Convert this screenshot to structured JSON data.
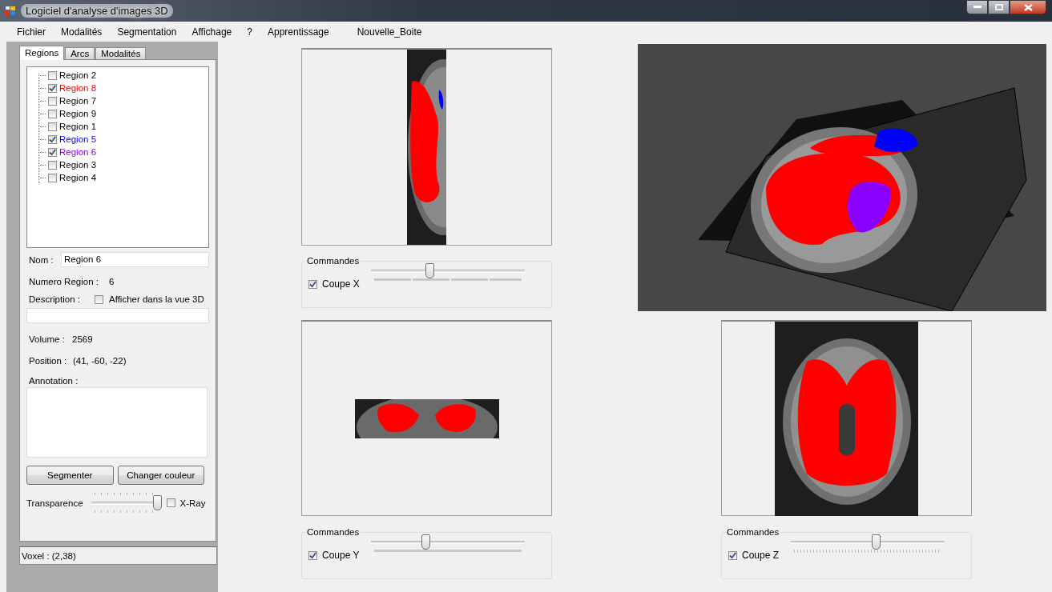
{
  "window": {
    "title": "Logiciel d'analyse d'images 3D"
  },
  "menu": [
    "Fichier",
    "Modalités",
    "Segmentation",
    "Affichage",
    "?",
    "Apprentissage",
    "Nouvelle_Boite"
  ],
  "tabs": [
    {
      "label": "Regions",
      "selected": true
    },
    {
      "label": "Arcs",
      "selected": false
    },
    {
      "label": "Modalités",
      "selected": false
    }
  ],
  "regions": [
    {
      "label": "Region 2",
      "checked": false,
      "color": "#000000"
    },
    {
      "label": "Region 8",
      "checked": true,
      "color": "#ff0000"
    },
    {
      "label": "Region 7",
      "checked": false,
      "color": "#000000"
    },
    {
      "label": "Region 9",
      "checked": false,
      "color": "#000000"
    },
    {
      "label": "Region 1",
      "checked": false,
      "color": "#000000"
    },
    {
      "label": "Region 5",
      "checked": true,
      "color": "#0000ff"
    },
    {
      "label": "Region 6",
      "checked": true,
      "color": "#8000ff"
    },
    {
      "label": "Region 3",
      "checked": false,
      "color": "#000000"
    },
    {
      "label": "Region 4",
      "checked": false,
      "color": "#000000"
    }
  ],
  "details": {
    "nom_label": "Nom :",
    "nom_value": "Region 6",
    "numero_label": "Numero Region :",
    "numero_value": "6",
    "description_label": "Description :",
    "afficher_3d": {
      "label": "Afficher dans la vue 3D",
      "checked": false
    },
    "volume_label": "Volume :",
    "volume_value": "2569",
    "position_label": "Position :",
    "position_value": "(41, -60, -22)",
    "annotation_label": "Annotation :"
  },
  "buttons": [
    "Segmenter",
    "Changer couleur"
  ],
  "transparence": {
    "label": "Transparence",
    "level": 1
  },
  "xray": {
    "label": "X-Ray",
    "checked": false
  },
  "status": "Voxel :  (2,38)",
  "slices": [
    {
      "kind": "sagittal",
      "group_label": "Commandes",
      "checkbox_label": "Coupe X",
      "checked": true,
      "level": 0.375
    },
    {
      "kind": "coronal",
      "group_label": "Commandes",
      "checkbox_label": "Coupe Y",
      "checked": true,
      "level": 0.35
    },
    {
      "kind": "axial",
      "group_label": "Commandes",
      "checkbox_label": "Coupe Z",
      "checked": true,
      "level": 0.557
    }
  ]
}
